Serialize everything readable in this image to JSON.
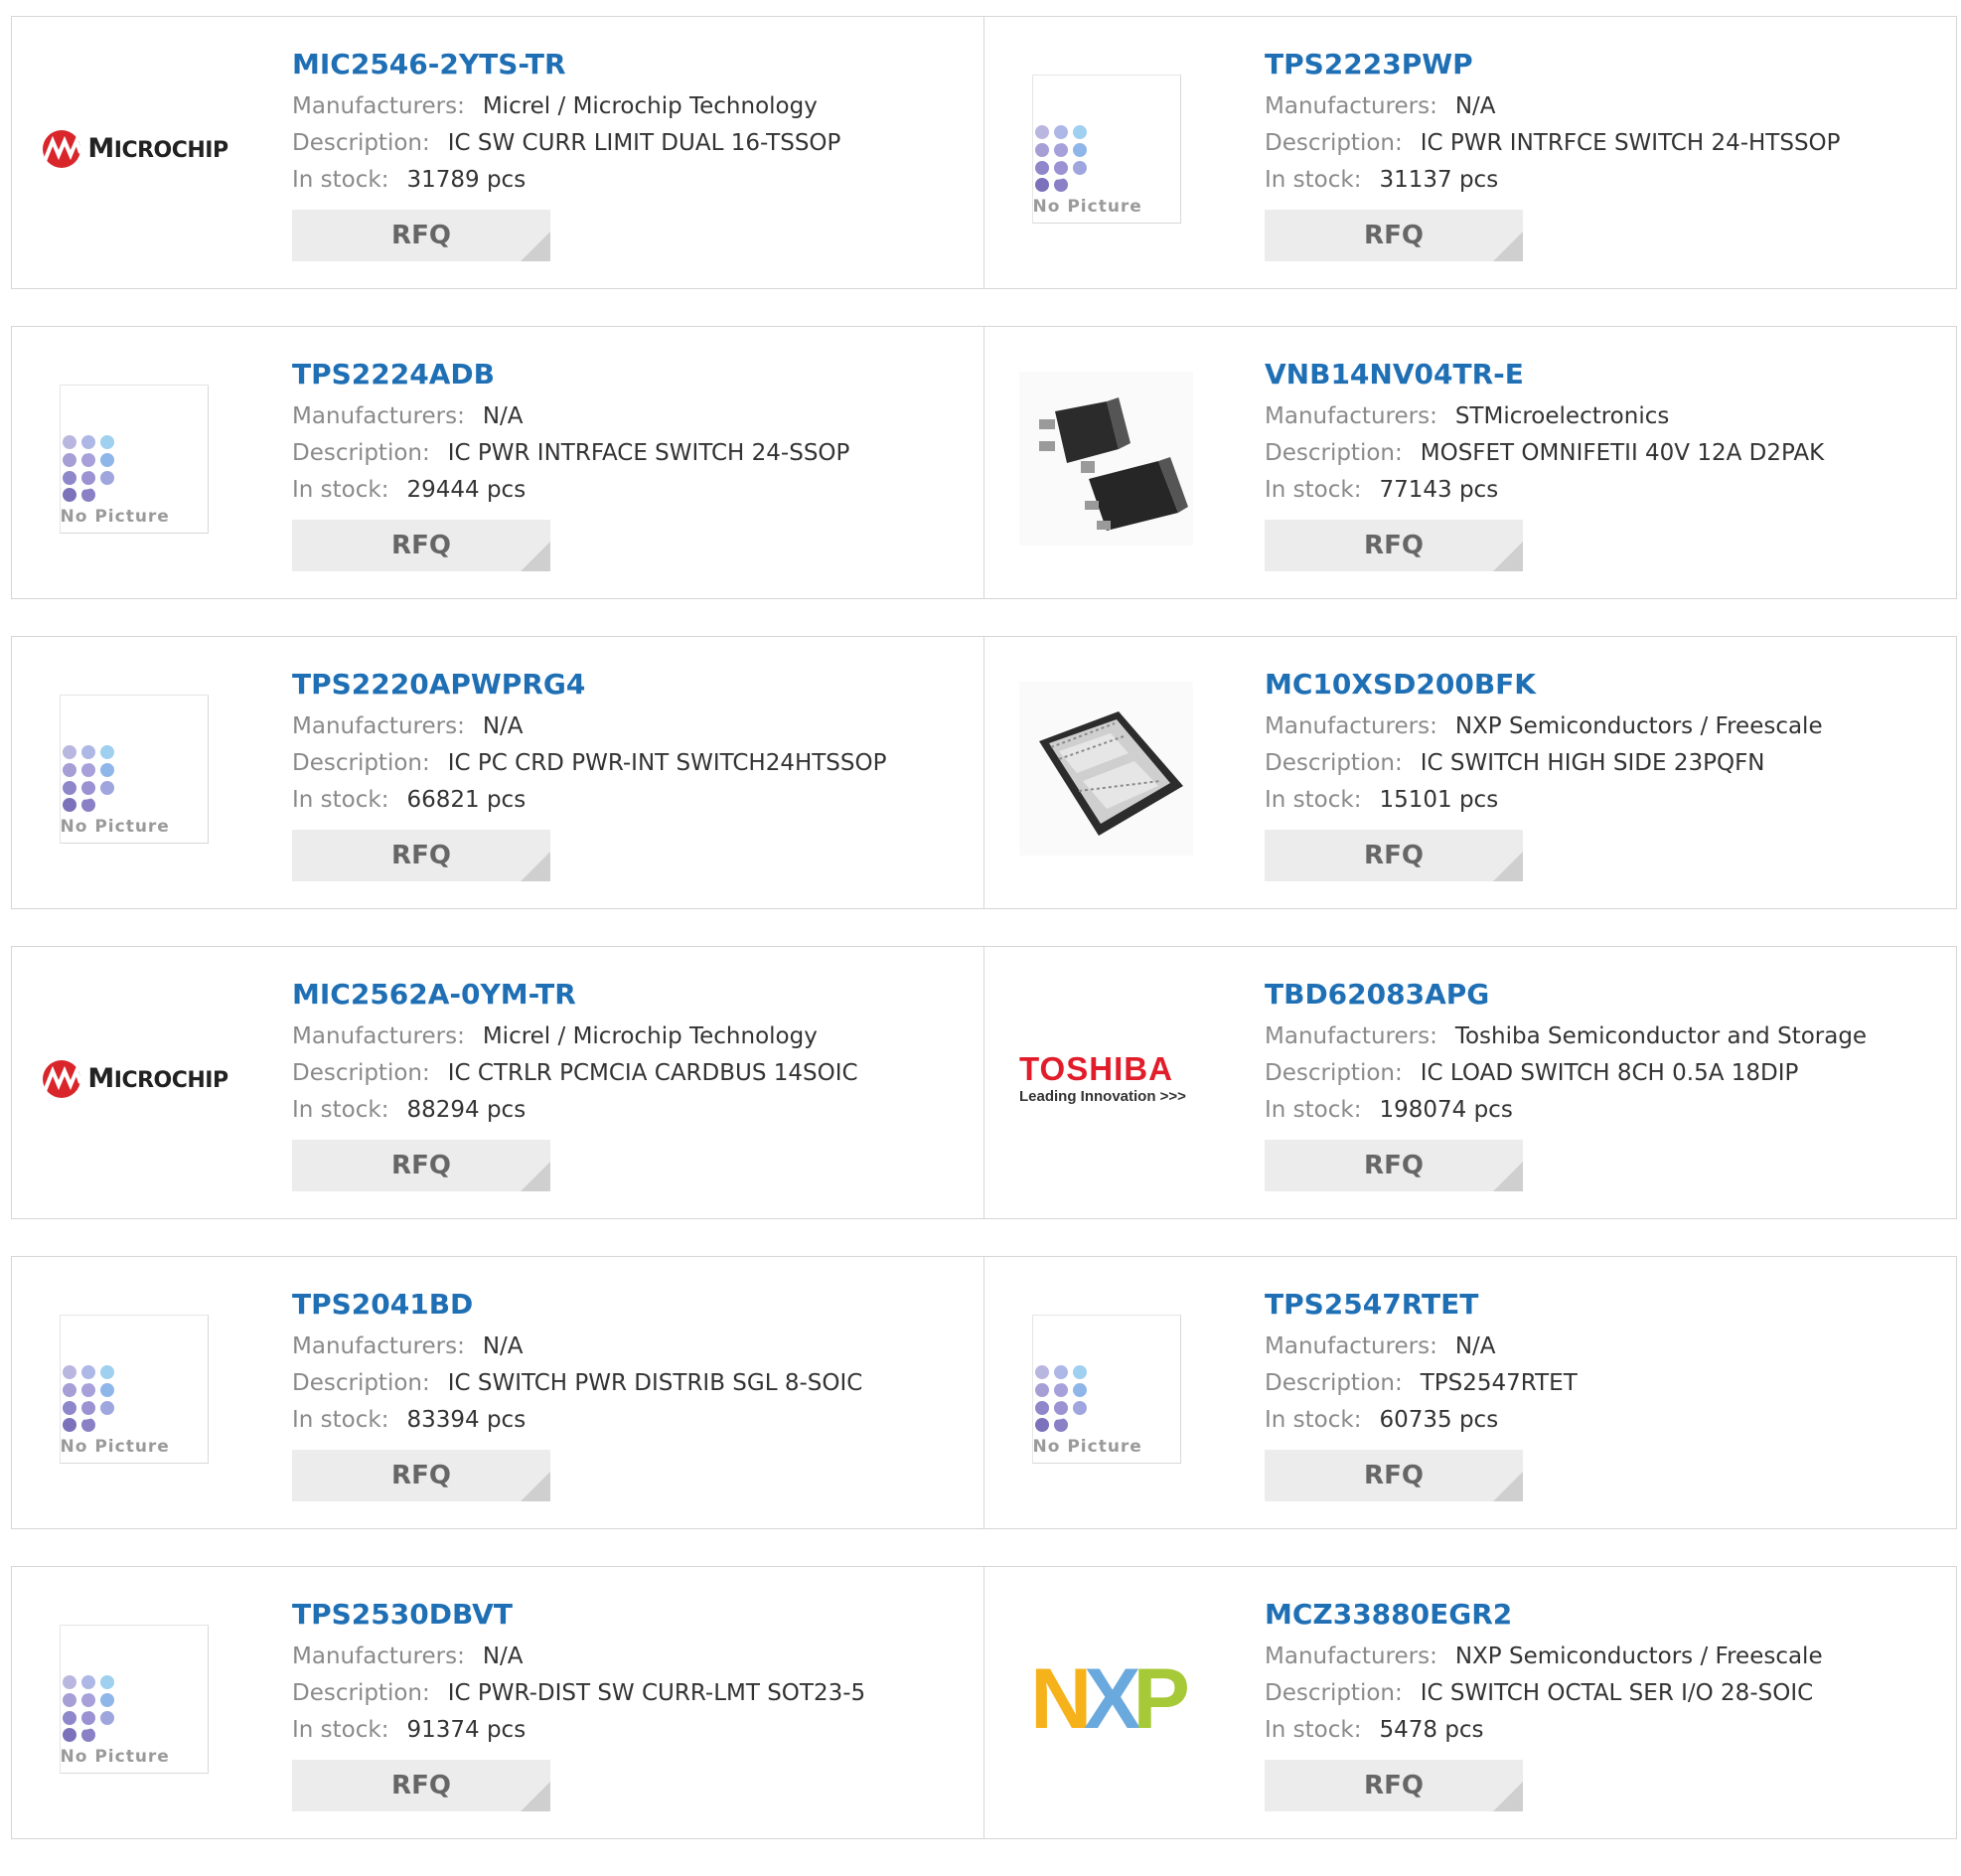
{
  "labels": {
    "manufacturers": "Manufacturers:",
    "description": "Description:",
    "in_stock": "In stock:",
    "rfq": "RFQ",
    "no_picture": "No Picture"
  },
  "logos": {
    "microchip": "Microchip",
    "toshiba": "TOSHIBA",
    "toshiba_tagline": "Leading Innovation >>>",
    "nxp": "NXP"
  },
  "colors": {
    "part_link": "#1f6fb5",
    "label": "#8a8a8a",
    "value": "#333333",
    "rfq_bg": "#ececec",
    "border": "#d6d6d6"
  },
  "products": [
    {
      "part": "MIC2546-2YTS-TR",
      "manufacturer": "Micrel / Microchip Technology",
      "description": "IC SW CURR LIMIT DUAL 16-TSSOP",
      "stock": "31789 pcs",
      "image": "microchip-logo"
    },
    {
      "part": "TPS2223PWP",
      "manufacturer": "N/A",
      "description": "IC PWR INTRFCE SWITCH 24-HTSSOP",
      "stock": "31137 pcs",
      "image": "no-picture"
    },
    {
      "part": "TPS2224ADB",
      "manufacturer": "N/A",
      "description": "IC PWR INTRFACE SWITCH 24-SSOP",
      "stock": "29444 pcs",
      "image": "no-picture"
    },
    {
      "part": "VNB14NV04TR-E",
      "manufacturer": "STMicroelectronics",
      "description": "MOSFET OMNIFETII 40V 12A D2PAK",
      "stock": "77143 pcs",
      "image": "d2pak-package"
    },
    {
      "part": "TPS2220APWPRG4",
      "manufacturer": "N/A",
      "description": "IC PC CRD PWR-INT SWITCH24HTSSOP",
      "stock": "66821 pcs",
      "image": "no-picture"
    },
    {
      "part": "MC10XSD200BFK",
      "manufacturer": "NXP Semiconductors / Freescale",
      "description": "IC SWITCH HIGH SIDE 23PQFN",
      "stock": "15101 pcs",
      "image": "pqfn-package"
    },
    {
      "part": "MIC2562A-0YM-TR",
      "manufacturer": "Micrel / Microchip Technology",
      "description": "IC CTRLR PCMCIA CARDBUS 14SOIC",
      "stock": "88294 pcs",
      "image": "microchip-logo"
    },
    {
      "part": "TBD62083APG",
      "manufacturer": "Toshiba Semiconductor and Storage",
      "description": "IC LOAD SWITCH 8CH 0.5A 18DIP",
      "stock": "198074 pcs",
      "image": "toshiba-logo"
    },
    {
      "part": "TPS2041BD",
      "manufacturer": "N/A",
      "description": "IC SWITCH PWR DISTRIB SGL 8-SOIC",
      "stock": "83394 pcs",
      "image": "no-picture"
    },
    {
      "part": "TPS2547RTET",
      "manufacturer": "N/A",
      "description": "TPS2547RTET",
      "stock": "60735 pcs",
      "image": "no-picture"
    },
    {
      "part": "TPS2530DBVT",
      "manufacturer": "N/A",
      "description": "IC PWR-DIST SW CURR-LMT SOT23-5",
      "stock": "91374 pcs",
      "image": "no-picture"
    },
    {
      "part": "MCZ33880EGR2",
      "manufacturer": "NXP Semiconductors / Freescale",
      "description": "IC SWITCH OCTAL SER I/O 28-SOIC",
      "stock": "5478 pcs",
      "image": "nxp-logo"
    }
  ]
}
